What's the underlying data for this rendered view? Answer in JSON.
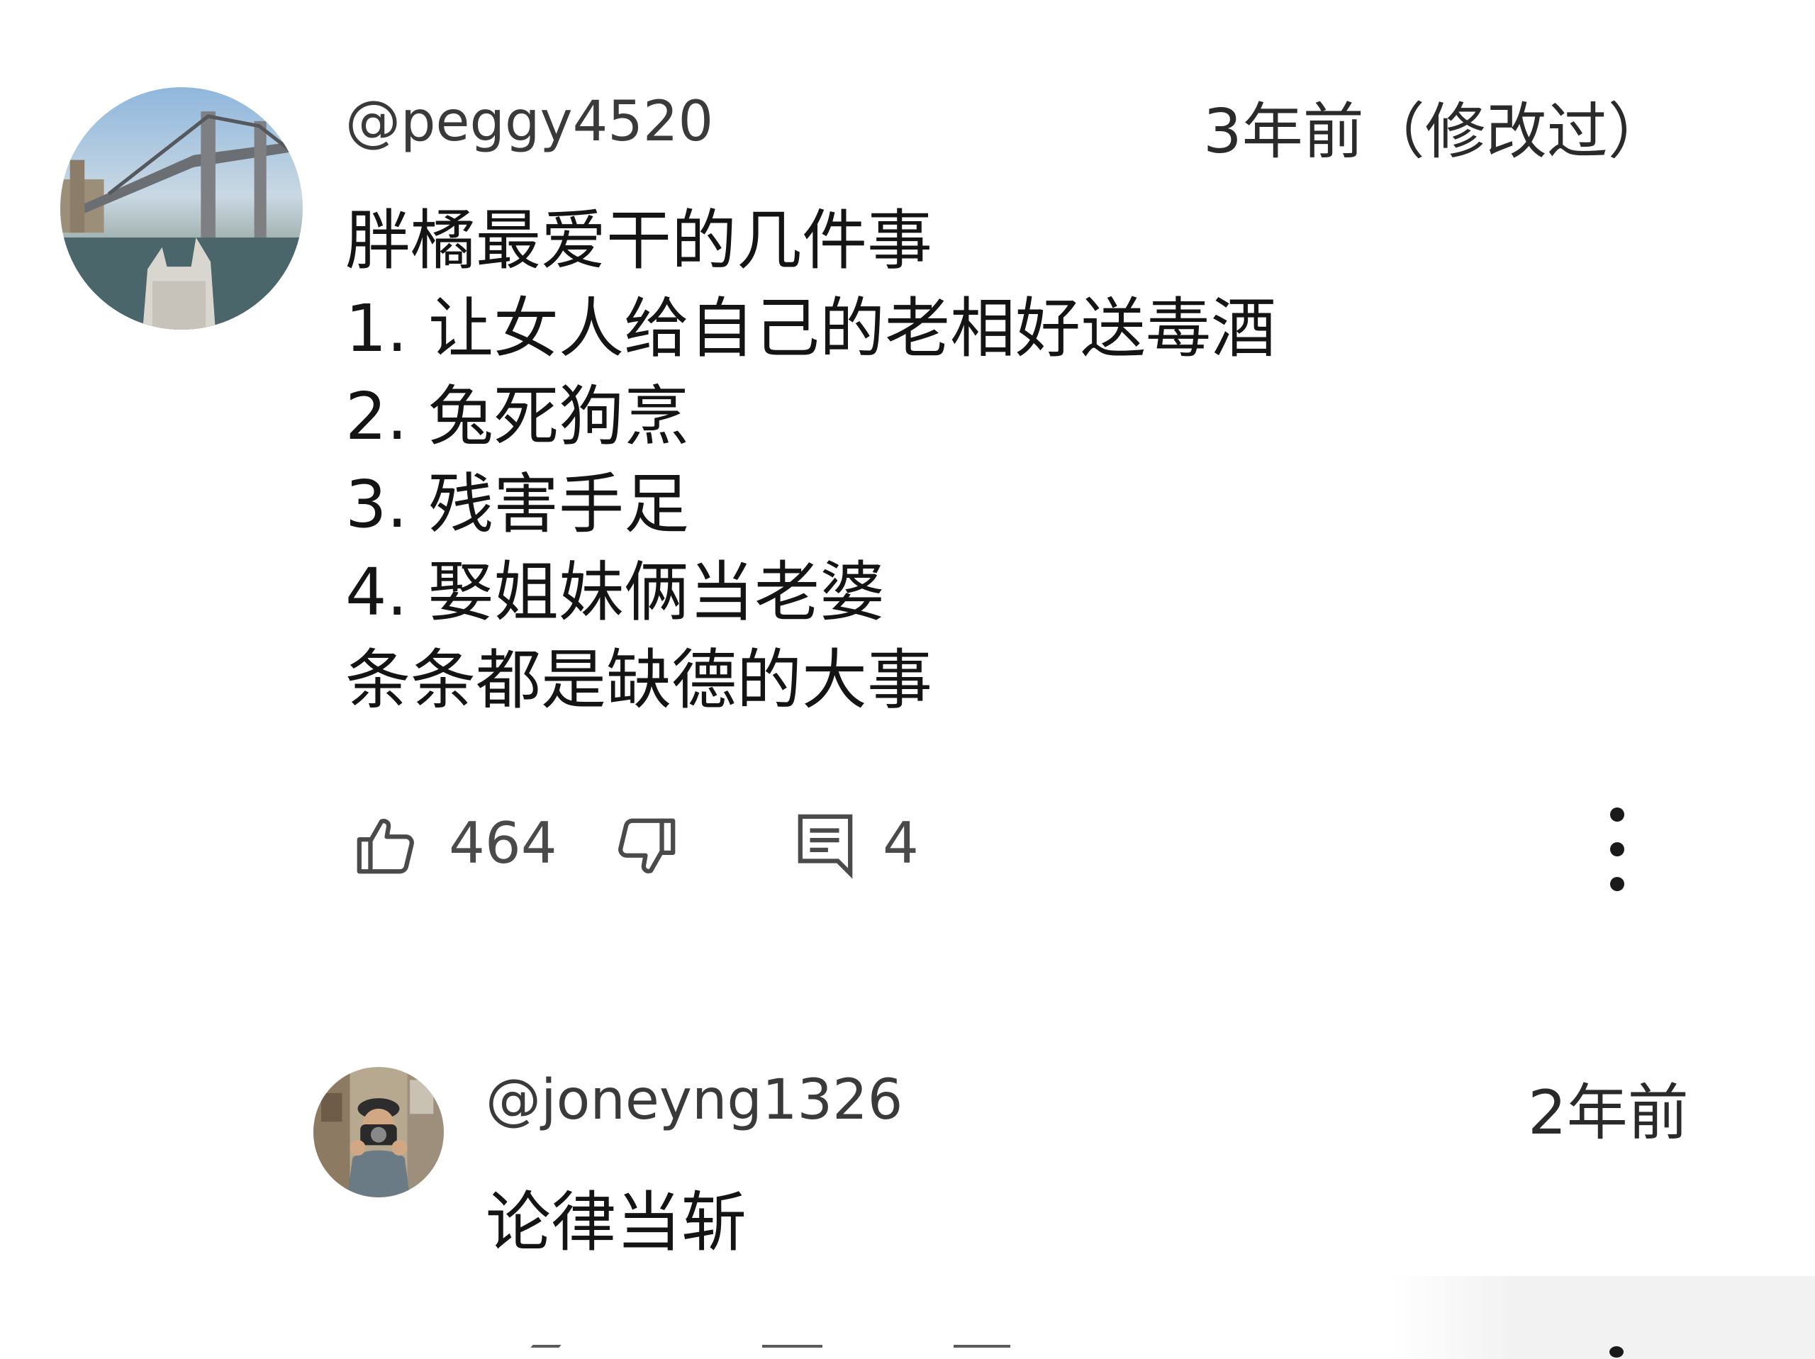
{
  "comment": {
    "author": "@peggy4520",
    "timestamp": "3年前（修改过）",
    "lines": [
      "胖橘最爱干的几件事",
      "1. 让女人给自己的老相好送毒酒",
      "2. 兔死狗烹",
      "3. 残害手足",
      "4. 娶姐妹俩当老婆",
      "条条都是缺德的大事"
    ],
    "like_count": "464",
    "reply_count": "4",
    "icons": {
      "like": "thumbs-up-icon",
      "dislike": "thumbs-down-icon",
      "reply": "comment-icon",
      "more": "more-vertical-icon"
    }
  },
  "reply": {
    "author": "@joneyng1326",
    "timestamp": "2年前",
    "text": "论律当斩"
  },
  "colors": {
    "background": "#ffffff",
    "text": "#141414",
    "meta_text": "#3a3a3a",
    "icon": "#4a4a4a"
  }
}
